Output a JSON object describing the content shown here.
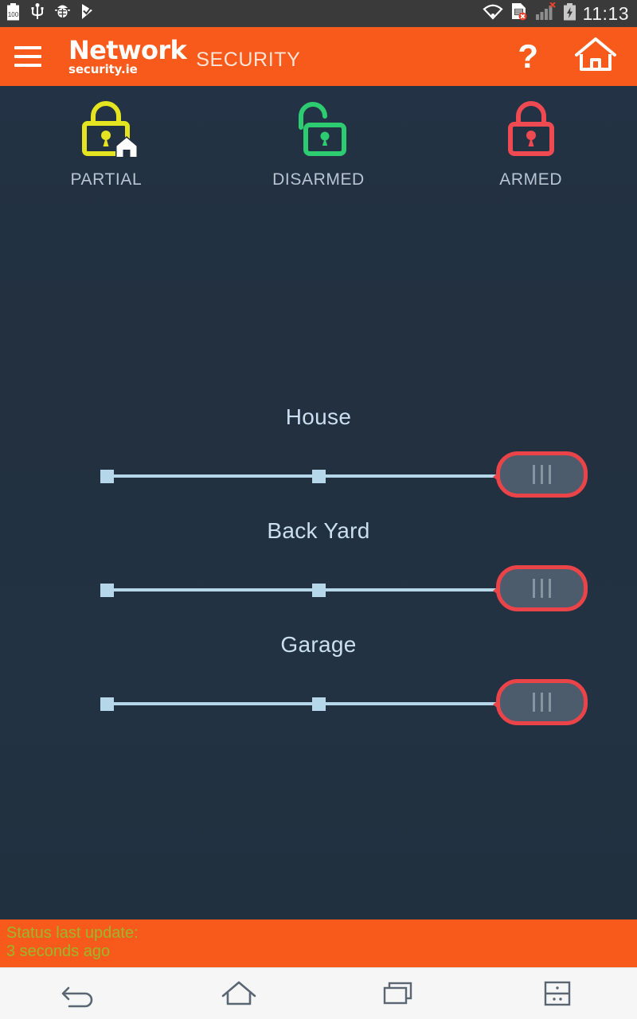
{
  "status_bar": {
    "left_icons": [
      "battery-100-icon",
      "usb-icon",
      "bug-icon",
      "checkmark-flag-icon"
    ],
    "right_icons": [
      "wifi-icon",
      "sim-card-error-icon",
      "signal-bars-error-icon",
      "battery-charging-icon"
    ],
    "clock": "11:13"
  },
  "header": {
    "menu_icon": "hamburger-menu-icon",
    "brand_top": "Network",
    "brand_sub": "security.ie",
    "brand_word": "SECURITY",
    "help_label": "?",
    "home_icon": "home-icon",
    "background_color": "#f85a1b"
  },
  "modes": [
    {
      "id": "partial",
      "label": "PARTIAL",
      "icon": "padlock-locked-house-icon",
      "color": "#e4e420"
    },
    {
      "id": "disarmed",
      "label": "DISARMED",
      "icon": "padlock-unlocked-icon",
      "color": "#2ecc71"
    },
    {
      "id": "armed",
      "label": "ARMED",
      "icon": "padlock-locked-icon",
      "color": "#ef4a52"
    }
  ],
  "zones": [
    {
      "id": "house",
      "title": "House",
      "thumb_icon": "grip-handle-icon"
    },
    {
      "id": "back-yard",
      "title": "Back Yard",
      "thumb_icon": "grip-handle-icon"
    },
    {
      "id": "garage",
      "title": "Garage",
      "thumb_icon": "grip-handle-icon"
    }
  ],
  "footer": {
    "line1": "Status last update:",
    "line2": "3 seconds ago",
    "text_color": "#9bb72a"
  },
  "nav_bar": {
    "back_icon": "back-arrow-icon",
    "home_icon": "home-outline-icon",
    "recents_icon": "recent-apps-icon",
    "menu_icon": "split-screen-menu-icon"
  },
  "theme": {
    "background": "#22303f",
    "accent_orange": "#f85a1b",
    "track_blue": "#b6d6e9",
    "thumb_red": "#ea4449",
    "thumb_fill": "#4d5c6d"
  }
}
